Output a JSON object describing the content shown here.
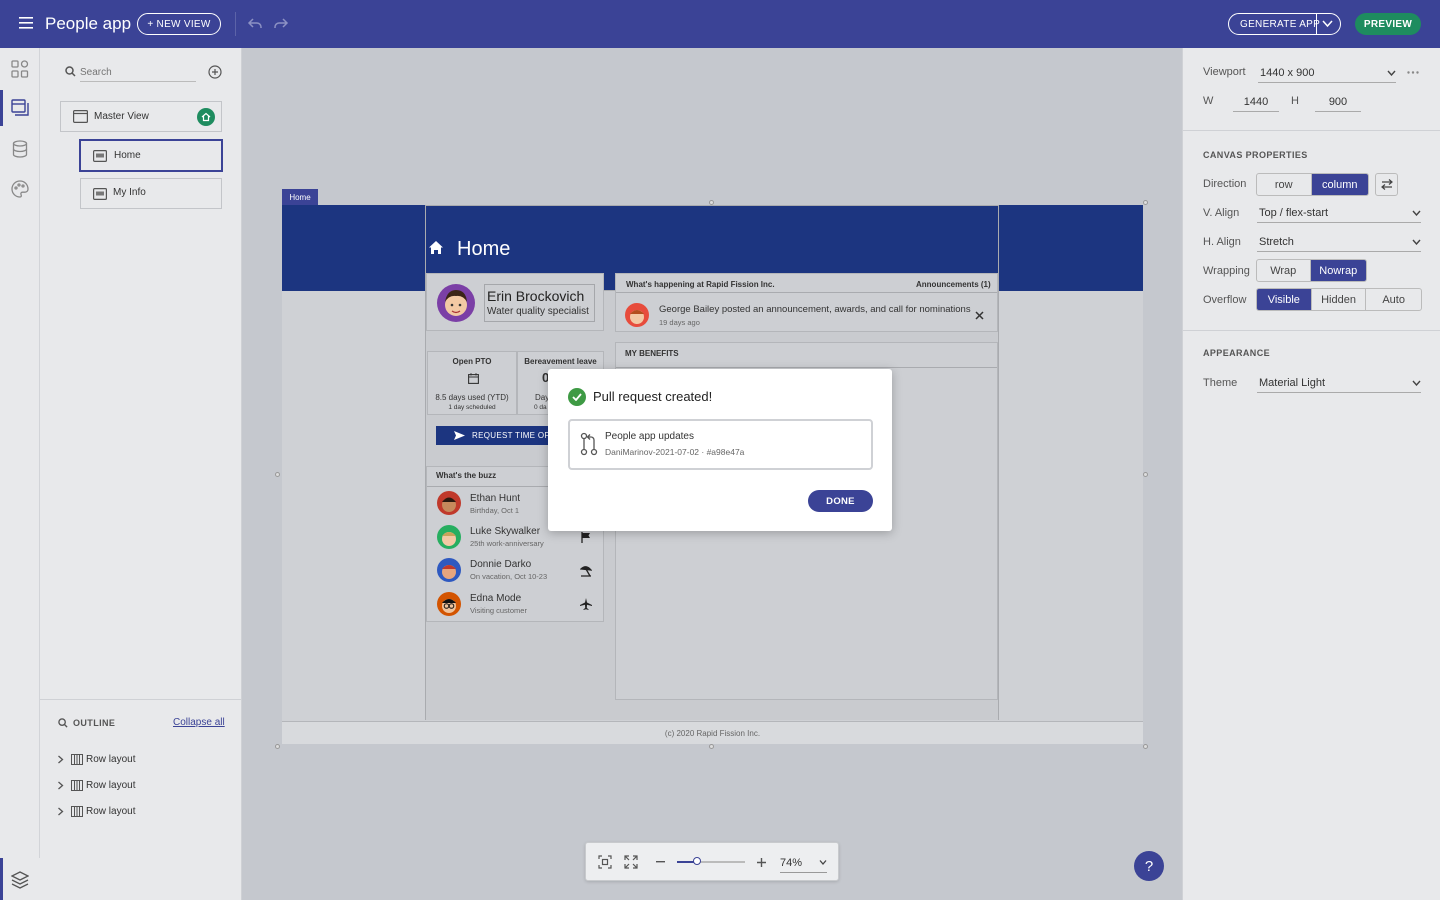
{
  "app": {
    "title": "People app",
    "new_view": "+ NEW VIEW",
    "generate": "GENERATE APP",
    "preview": "PREVIEW"
  },
  "left": {
    "search_placeholder": "Search",
    "tree": [
      {
        "label": "Master View"
      },
      {
        "label": "Home"
      },
      {
        "label": "My Info"
      }
    ],
    "outline_label": "OUTLINE",
    "collapse_all": "Collapse all",
    "outline_items": [
      "Row layout",
      "Row layout",
      "Row layout"
    ]
  },
  "right": {
    "viewport_label": "Viewport",
    "viewport_value": "1440 x 900",
    "w_label": "W",
    "w_value": "1440",
    "h_label": "H",
    "h_value": "900",
    "canvas_props": "CANVAS PROPERTIES",
    "direction_label": "Direction",
    "direction_options": [
      "row",
      "column"
    ],
    "direction_selected": "column",
    "valign_label": "V. Align",
    "valign_value": "Top / flex-start",
    "halign_label": "H. Align",
    "halign_value": "Stretch",
    "wrapping_label": "Wrapping",
    "wrapping_options": [
      "Wrap",
      "Nowrap"
    ],
    "wrapping_selected": "Nowrap",
    "overflow_label": "Overflow",
    "overflow_options": [
      "Visible",
      "Hidden",
      "Auto"
    ],
    "overflow_selected": "Visible",
    "appearance": "APPEARANCE",
    "theme_label": "Theme",
    "theme_value": "Material Light"
  },
  "canvas": {
    "tag": "Home",
    "page_title": "Home",
    "profile": {
      "name": "Erin Brockovich",
      "role": "Water quality specialist"
    },
    "pto": {
      "title": "Open PTO",
      "used": "8.5 days used (YTD)",
      "scheduled": "1 day scheduled"
    },
    "bereavement": {
      "title": "Bereavement leave",
      "value": "0",
      "sub1": "Day",
      "sub2": "0 da"
    },
    "request_btn": "REQUEST TIME OFF",
    "news": {
      "title": "What's happening at Rapid Fission Inc.",
      "announcements": "Announcements (1)",
      "item": "George Bailey posted an announcement, awards, and call for nominations",
      "item_time": "19 days ago"
    },
    "benefits": "MY BENEFITS",
    "buzz": {
      "title": "What's the buzz",
      "people": [
        {
          "name": "Ethan Hunt",
          "sub": "Birthday, Oct 1",
          "icon": "none",
          "color": "#c0392b"
        },
        {
          "name": "Luke Skywalker",
          "sub": "25th work-anniversary",
          "icon": "flag-icon",
          "color": "#27ae60"
        },
        {
          "name": "Donnie Darko",
          "sub": "On vacation, Oct 10-23",
          "icon": "beach-icon",
          "color": "#2e59c0"
        },
        {
          "name": "Edna Mode",
          "sub": "Visiting customer",
          "icon": "airplane-icon",
          "color": "#d35400"
        }
      ]
    },
    "footer": "(c) 2020 Rapid Fission Inc."
  },
  "dialog": {
    "title": "Pull request created!",
    "pr_title": "People app updates",
    "pr_meta": "DaniMarinov-2021-07-02 · #a98e47a",
    "done": "DONE"
  },
  "zoom": {
    "value": "74%",
    "level": 0.3
  },
  "colors": {
    "primary": "#3b4396",
    "success": "#1e8c5f",
    "check": "#3e9a44"
  }
}
